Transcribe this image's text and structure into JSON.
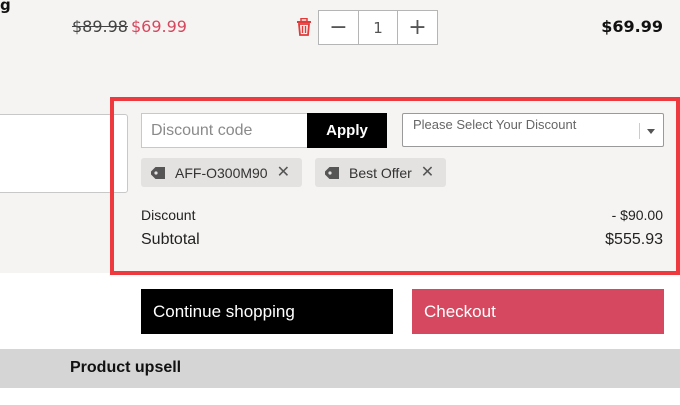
{
  "cart": {
    "item_name_fragment": "g",
    "price_original": "$89.98",
    "price_sale": "$69.99",
    "quantity": "1",
    "qty_minus_glyph": "−",
    "qty_plus_glyph": "+",
    "line_total": "$69.99",
    "remove_icon": "trash-icon"
  },
  "discount": {
    "code_placeholder": "Discount code",
    "apply_label": "Apply",
    "select_placeholder": "Please Select Your Discount",
    "chips": [
      {
        "label": "AFF-O300M90",
        "icon": "tag-icon",
        "remove_glyph": "✕"
      },
      {
        "label": "Best Offer",
        "icon": "tag-icon",
        "remove_glyph": "✕"
      }
    ]
  },
  "summary": {
    "discount_label": "Discount",
    "discount_value": "- $90.00",
    "subtotal_label": "Subtotal",
    "subtotal_value": "$555.93"
  },
  "actions": {
    "continue_label": "Continue shopping",
    "checkout_label": "Checkout"
  },
  "upsell": {
    "title": "Product upsell"
  },
  "colors": {
    "accent": "#d5485f",
    "highlight_border": "#ee3a3e",
    "band_background": "#f6f4f2",
    "primary_button": "#000000"
  }
}
